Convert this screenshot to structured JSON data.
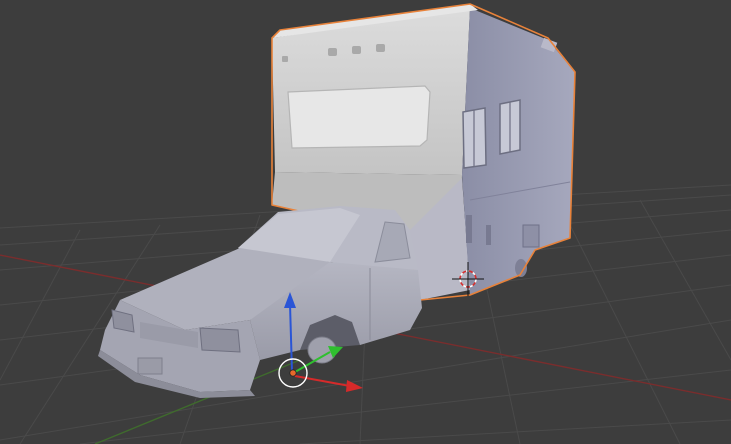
{
  "viewport": {
    "background": "#3d3d3d",
    "grid_color": "#4a4a4a",
    "x_axis_color": "#7a2d2d",
    "y_axis_color": "#3f6b2d"
  },
  "objects": [
    {
      "name": "camper",
      "selected": true,
      "outline_color": "#e8823a"
    },
    {
      "name": "car",
      "selected": false
    }
  ],
  "gizmo": {
    "x_color": "#d62a2a",
    "y_color": "#2fbf2f",
    "z_color": "#2a55d6",
    "origin_color": "#e8692a"
  },
  "cursor_3d": {
    "icon": "3d-cursor-icon"
  }
}
